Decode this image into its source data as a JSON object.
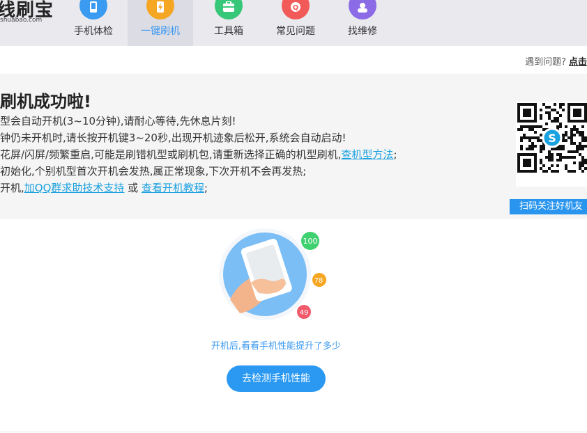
{
  "header": {
    "logo_text": "线刷宝",
    "logo_sub": "shuabao.com",
    "nav": [
      {
        "label": "手机体检",
        "icon": "phone-check-icon",
        "color": "#3a9bf0"
      },
      {
        "label": "一键刷机",
        "icon": "flash-icon",
        "color": "#f5a623",
        "active": true
      },
      {
        "label": "工具箱",
        "icon": "toolbox-icon",
        "color": "#37c779"
      },
      {
        "label": "常见问题",
        "icon": "question-icon",
        "color": "#f25a5a"
      },
      {
        "label": "找维修",
        "icon": "repair-icon",
        "color": "#8b6be6"
      }
    ]
  },
  "help": {
    "prefix": "遇到问题?",
    "link": "点击"
  },
  "success": {
    "title": "刷机成功啦!",
    "tips": [
      {
        "text": "型会自动开机(3~10分钟),请耐心等待,先休息片刻!"
      },
      {
        "text": "钟仍未开机时,请长按开机键3~20秒,出现开机迹象后松开,系统会自动启动!"
      },
      {
        "text": "花屏/闪屏/频繁重启,可能是刷错机型或刷机包,请重新选择正确的机型刷机,",
        "link": "查机型方法",
        "suffix": ";"
      },
      {
        "text": "初始化,个别机型首次开机会发热,属正常现象,下次开机不会再发热;"
      },
      {
        "text": "开机,",
        "link": "加QQ群求助技术支持",
        "middle": " 或 ",
        "link2": "查看开机教程",
        "suffix": ";"
      }
    ],
    "qr_button": "扫码关注好机友"
  },
  "performance": {
    "scores": [
      "100",
      "78",
      "49"
    ],
    "score_colors": [
      "#3fd06f",
      "#f5a623",
      "#f05a6a"
    ],
    "hint": "开机后,看看手机性能提升了多少",
    "button": "去检测手机性能"
  }
}
